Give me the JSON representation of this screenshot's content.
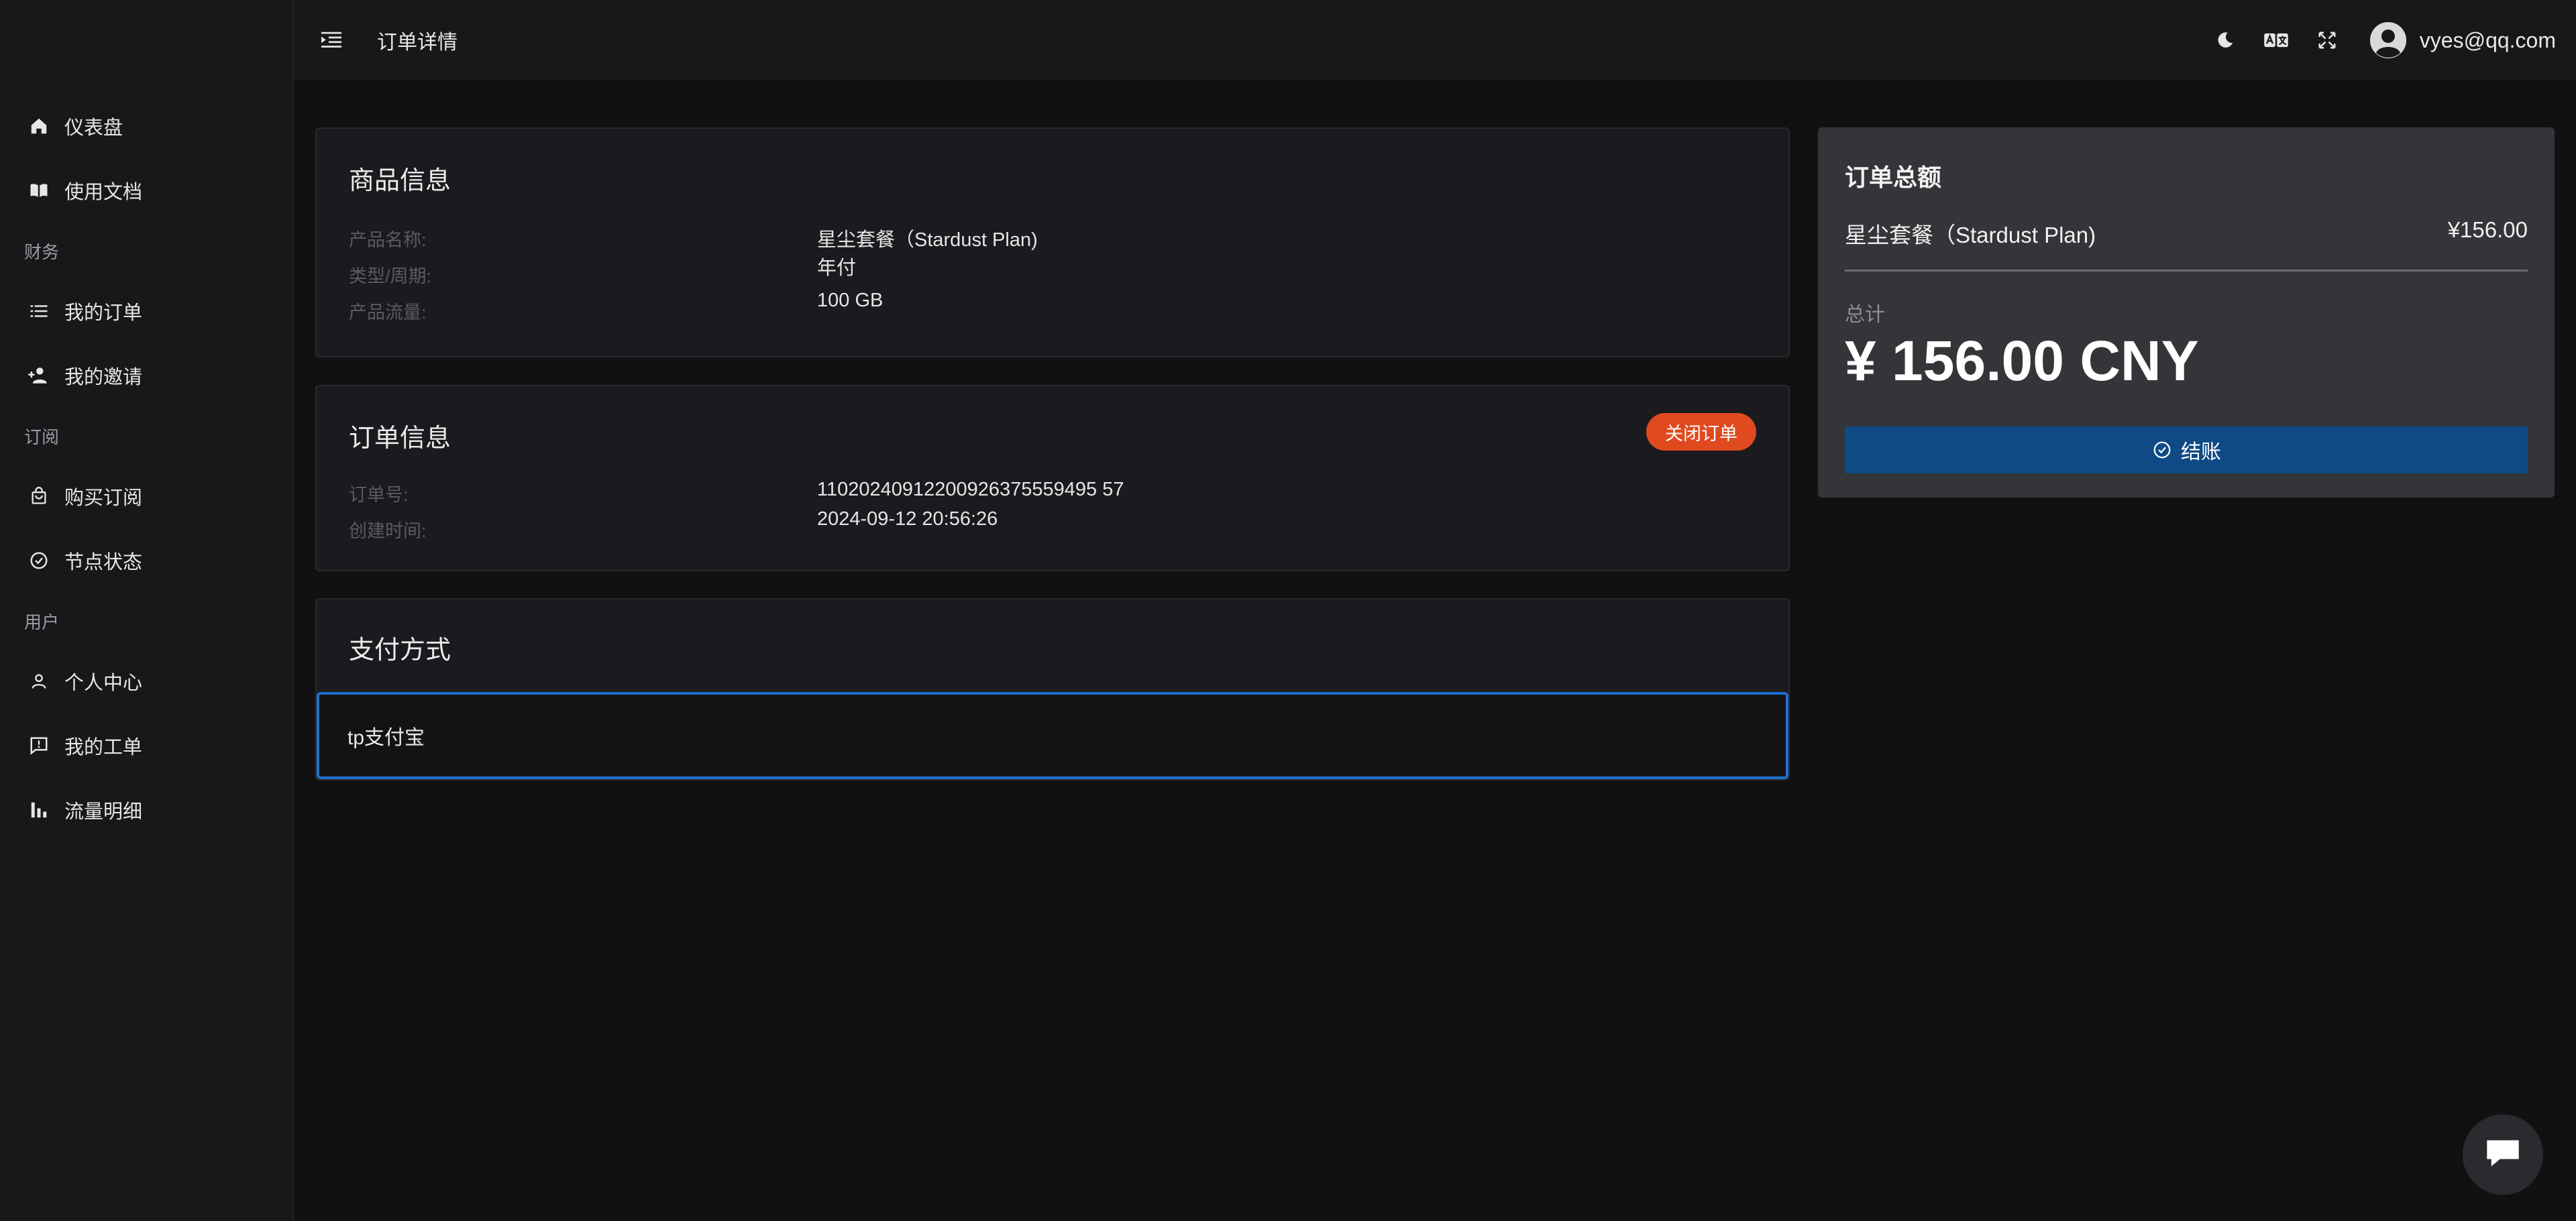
{
  "header": {
    "title": "订单详情",
    "user_email": "vyes@qq.com"
  },
  "sidebar": {
    "items": [
      {
        "type": "item",
        "label": "仪表盘",
        "icon": "home-icon"
      },
      {
        "type": "item",
        "label": "使用文档",
        "icon": "book-icon"
      },
      {
        "type": "group",
        "label": "财务"
      },
      {
        "type": "item",
        "label": "我的订单",
        "icon": "list-icon"
      },
      {
        "type": "item",
        "label": "我的邀请",
        "icon": "user-add-icon"
      },
      {
        "type": "group",
        "label": "订阅"
      },
      {
        "type": "item",
        "label": "购买订阅",
        "icon": "bag-icon"
      },
      {
        "type": "item",
        "label": "节点状态",
        "icon": "check-circle-icon"
      },
      {
        "type": "group",
        "label": "用户"
      },
      {
        "type": "item",
        "label": "个人中心",
        "icon": "person-icon"
      },
      {
        "type": "item",
        "label": "我的工单",
        "icon": "ticket-icon"
      },
      {
        "type": "item",
        "label": "流量明细",
        "icon": "bar-chart-icon"
      }
    ]
  },
  "product": {
    "title": "商品信息",
    "rows": [
      {
        "label": "产品名称:",
        "value": "星尘套餐（Stardust Plan)"
      },
      {
        "label": "类型/周期:",
        "value": "年付"
      },
      {
        "label": "产品流量:",
        "value": "100 GB"
      }
    ]
  },
  "order": {
    "title": "订单信息",
    "close_label": "关闭订单",
    "rows": [
      {
        "label": "订单号:",
        "value": "11020240912200926375559495 57"
      },
      {
        "label": "创建时间:",
        "value": "2024-09-12 20:56:26"
      }
    ]
  },
  "payment": {
    "title": "支付方式",
    "option": "tp支付宝"
  },
  "summary": {
    "title": "订单总额",
    "item_name": "星尘套餐（Stardust Plan)",
    "item_price": "¥156.00",
    "total_label": "总计",
    "total": "¥ 156.00 CNY",
    "checkout_label": "结账"
  },
  "colors": {
    "accent": "#0f4a86",
    "danger": "#e04a1f",
    "selected_border": "#1e6fd0"
  }
}
